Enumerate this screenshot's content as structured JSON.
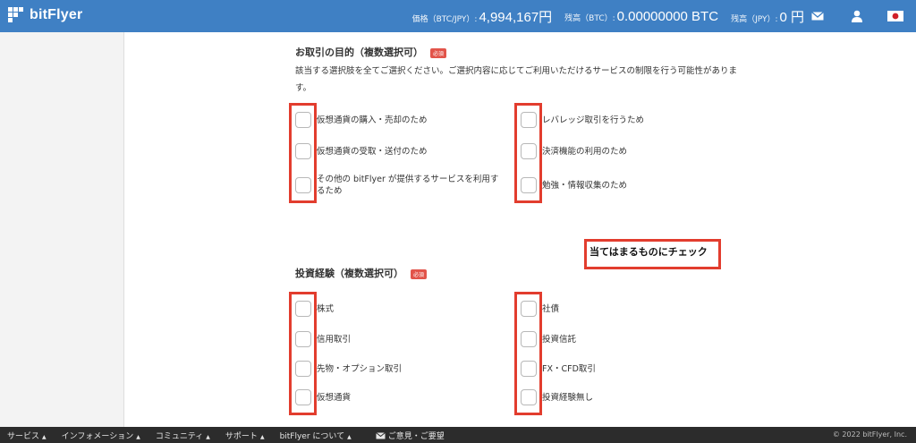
{
  "header": {
    "brand": "bitFlyer",
    "price_label": "価格（BTC/JPY）:",
    "price_value": "4,994,167円",
    "btc_label": "残高（BTC）:",
    "btc_value": "0.00000000 BTC",
    "jpy_label": "残高（JPY）:",
    "jpy_value": "0 円",
    "icons": [
      "mail-icon",
      "user-icon",
      "japan-flag-icon"
    ]
  },
  "purpose": {
    "title": "お取引の目的（複数選択可）",
    "badge": "必須",
    "description": "該当する選択肢を全てご選択ください。ご選択内容に応じてご利用いただけるサービスの制限を行う可能性がありま す。",
    "options_left": [
      "仮想通貨の購入・売却のため",
      "仮想通貨の受取・送付のため",
      "その他の bitFlyer が提供するサービスを利用するため"
    ],
    "options_right": [
      "レバレッジ取引を行うため",
      "決済機能の利用のため",
      "勉強・情報収集のため"
    ]
  },
  "experience": {
    "title": "投資経験（複数選択可）",
    "badge": "必須",
    "options_left": [
      "株式",
      "信用取引",
      "先物・オプション取引",
      "仮想通貨"
    ],
    "options_right": [
      "社債",
      "投資信託",
      "FX・CFD取引",
      "投資経験無し"
    ]
  },
  "annotation": {
    "text": "当てはまるものにチェック",
    "color": "#e23d2e"
  },
  "footer": {
    "items": [
      "サービス",
      "インフォメーション",
      "コミュニティ",
      "サポート",
      "bitFlyer について"
    ],
    "feedback": "ご意見・ご要望",
    "copyright": "© 2022 bitFlyer, Inc."
  },
  "colors": {
    "header": "#3f80c4",
    "badge": "#e2544a",
    "footer": "#2c2c2c"
  }
}
